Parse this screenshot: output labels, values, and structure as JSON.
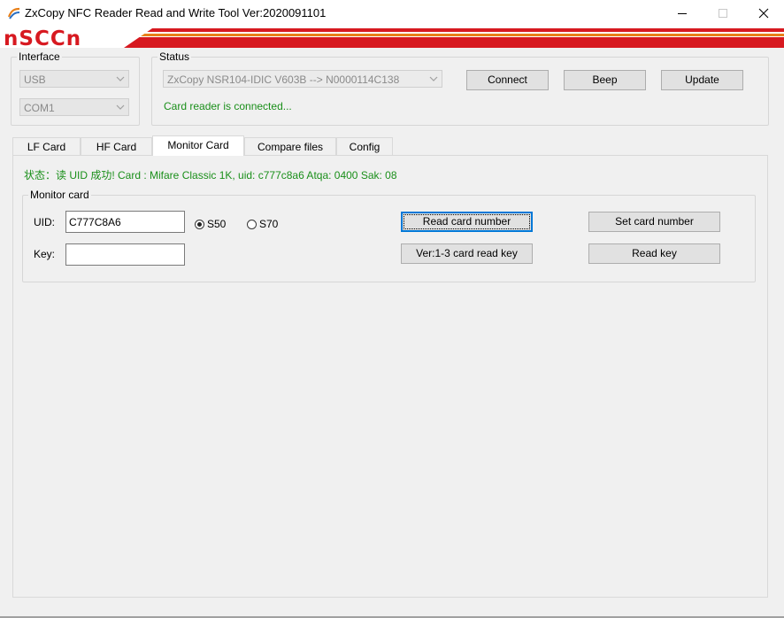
{
  "window": {
    "title": "ZxCopy NFC Reader Read and Write Tool  Ver:2020091101"
  },
  "banner": {
    "logo_text": "nSCCn",
    "accent_color": "#d71920"
  },
  "interface": {
    "label": "Interface",
    "type_value": "USB",
    "port_value": "COM1"
  },
  "status": {
    "label": "Status",
    "device_value": "ZxCopy NSR104-IDIC V603B --> N0000114C138",
    "message": "Card reader is connected...",
    "connect_label": "Connect",
    "beep_label": "Beep",
    "update_label": "Update"
  },
  "tabs": [
    {
      "label": "LF Card"
    },
    {
      "label": "HF Card"
    },
    {
      "label": "Monitor Card",
      "active": true
    },
    {
      "label": "Compare files"
    },
    {
      "label": "Config"
    }
  ],
  "monitor": {
    "status_line": "状态：读 UID 成功!  Card : Mifare Classic 1K, uid: c777c8a6    Atqa: 0400    Sak: 08",
    "group_label": "Monitor card",
    "uid_label": "UID:",
    "uid_value": "C777C8A6",
    "key_label": "Key:",
    "key_value": "",
    "s50_label": "S50",
    "s70_label": "S70",
    "selected_type": "S50",
    "read_card_number_label": "Read card number",
    "set_card_number_label": "Set card number",
    "read_key_v13_label": "Ver:1-3 card read key",
    "read_key_label": "Read key"
  }
}
